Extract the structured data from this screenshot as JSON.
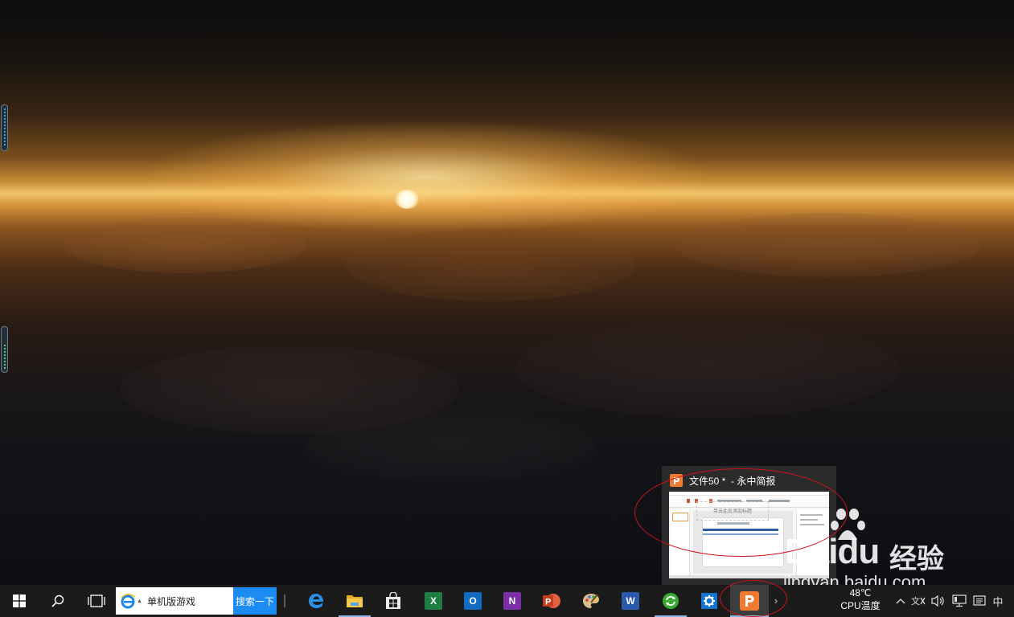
{
  "preview": {
    "window_title": "文件50 *  - 永中简报",
    "thumbnail": {
      "slide_title_placeholder": "单击此处添加标题"
    }
  },
  "taskbar": {
    "search_box": {
      "query": "单机版游戏",
      "button_label": "搜索一下"
    },
    "pinned_apps": [
      {
        "name": "Microsoft Edge",
        "icon": "edge-icon",
        "color": "#1e7ee0"
      },
      {
        "name": "File Explorer",
        "icon": "folder-icon",
        "color": "#f2c13d"
      },
      {
        "name": "Microsoft Store",
        "icon": "store-icon",
        "color": "#e9e9e9"
      },
      {
        "name": "Excel",
        "icon": "excel-icon",
        "color": "#1f7d44",
        "letter": "X"
      },
      {
        "name": "Outlook",
        "icon": "outlook-icon",
        "color": "#0f6cc2",
        "letter": "O"
      },
      {
        "name": "OneNote",
        "icon": "onenote-icon",
        "color": "#7a2fa6",
        "letter": "N"
      },
      {
        "name": "PowerPoint",
        "icon": "powerpoint-icon",
        "color": "#d04526",
        "letter": "P"
      },
      {
        "name": "Paint",
        "icon": "paint-palette-icon",
        "color": "#d9b46a"
      },
      {
        "name": "Word",
        "icon": "word-icon",
        "color": "#2b5aab",
        "letter": "W"
      },
      {
        "name": "Refresh app",
        "icon": "sync-icon",
        "color": "#3aaa35"
      },
      {
        "name": "Settings",
        "icon": "gear-icon",
        "color": "#1473d0"
      },
      {
        "name": "Yozo Office Presentation",
        "icon": "yozo-presentation-icon",
        "color": "#f07a30",
        "letter": "P"
      }
    ],
    "tray": {
      "cpu_temp": "48℃",
      "cpu_label": "CPU温度",
      "ime": "中"
    }
  },
  "watermark": {
    "brand_word": "Baidu",
    "brand_cn": "经验",
    "url": "jingyan.baidu.com"
  }
}
